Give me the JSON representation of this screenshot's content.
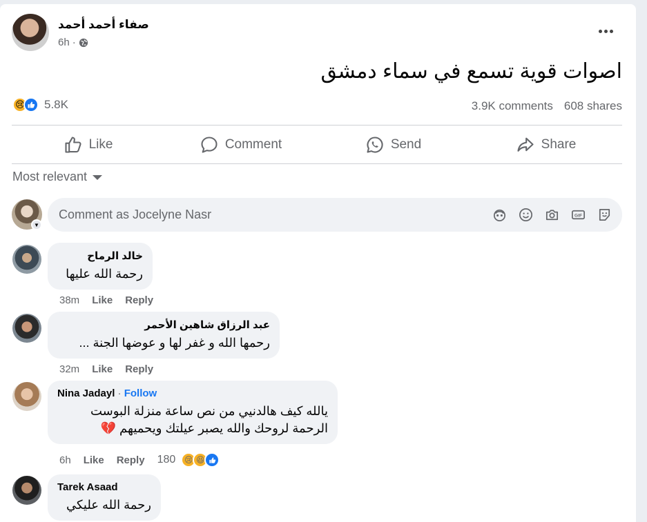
{
  "post": {
    "author": "صفاء أحمد أحمد",
    "time": "6h",
    "separator": "·",
    "privacy_icon": "globe-icon",
    "text": "اصوات قوية تسمع في سماء دمشق",
    "reaction_count": "5.8K",
    "comments_count": "3.9K comments",
    "shares_count": "608 shares"
  },
  "actions": {
    "like": "Like",
    "comment": "Comment",
    "send": "Send",
    "share": "Share"
  },
  "sort": {
    "label": "Most relevant"
  },
  "composer": {
    "placeholder": "Comment as Jocelyne Nasr",
    "icons": [
      "avatar-sticker-icon",
      "emoji-icon",
      "camera-icon",
      "gif-icon",
      "sticker-icon"
    ]
  },
  "comments": [
    {
      "name": "خالد الرماح",
      "text": "رحمة الله عليها",
      "time": "38m",
      "like": "Like",
      "reply": "Reply"
    },
    {
      "name": "عبد الرزاق شاهين الأحمر",
      "text": "رحمها الله و غفر لها و عوضها الجنة ...",
      "time": "32m",
      "like": "Like",
      "reply": "Reply"
    },
    {
      "name": "Nina Jadayl",
      "follow_sep": "·",
      "follow": "Follow",
      "line1": "يالله كيف هالدنيي من نص ساعة منزلة البوست",
      "line2": "الرحمة لروحك والله يصبر عيلتك ويحميهم 💔",
      "time": "6h",
      "like": "Like",
      "reply": "Reply",
      "reaction_count": "180"
    },
    {
      "name": "Tarek Asaad",
      "text": "رحمة الله عليكي"
    }
  ],
  "colors": {
    "accent": "#1877f2",
    "secondary_text": "#65676b",
    "bubble": "#f0f2f5"
  }
}
